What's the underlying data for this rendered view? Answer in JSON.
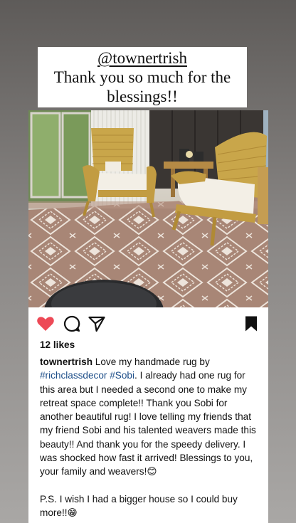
{
  "story": {
    "mention": "@townertrish",
    "message": "Thank you so much for the blessings!!"
  },
  "post": {
    "likes": "12 likes",
    "username": "townertrish",
    "caption_intro": " Love my handmade rug by ",
    "hashtag_1": "#richclassdecor",
    "hashtag_2": "#Sobi",
    "caption_body": ". I already had one rug for this area but I needed a second one to make my retreat space complete!! Thank you Sobi for another beautiful rug! I love telling my friends that my friend Sobi and his talented weavers made this beauty!! And thank you for the speedy delivery. I was shocked how fast it arrived! Blessings to you, your family and weavers!😊",
    "caption_ps": "P.S. I wish I had a bigger house so I could buy more!!😁"
  },
  "colors": {
    "like_heart": "#ed4956",
    "hashtag": "#1d4e89",
    "rug": "#a98a7a"
  },
  "icons": [
    "heart-icon",
    "comment-icon",
    "share-icon",
    "bookmark-icon"
  ]
}
